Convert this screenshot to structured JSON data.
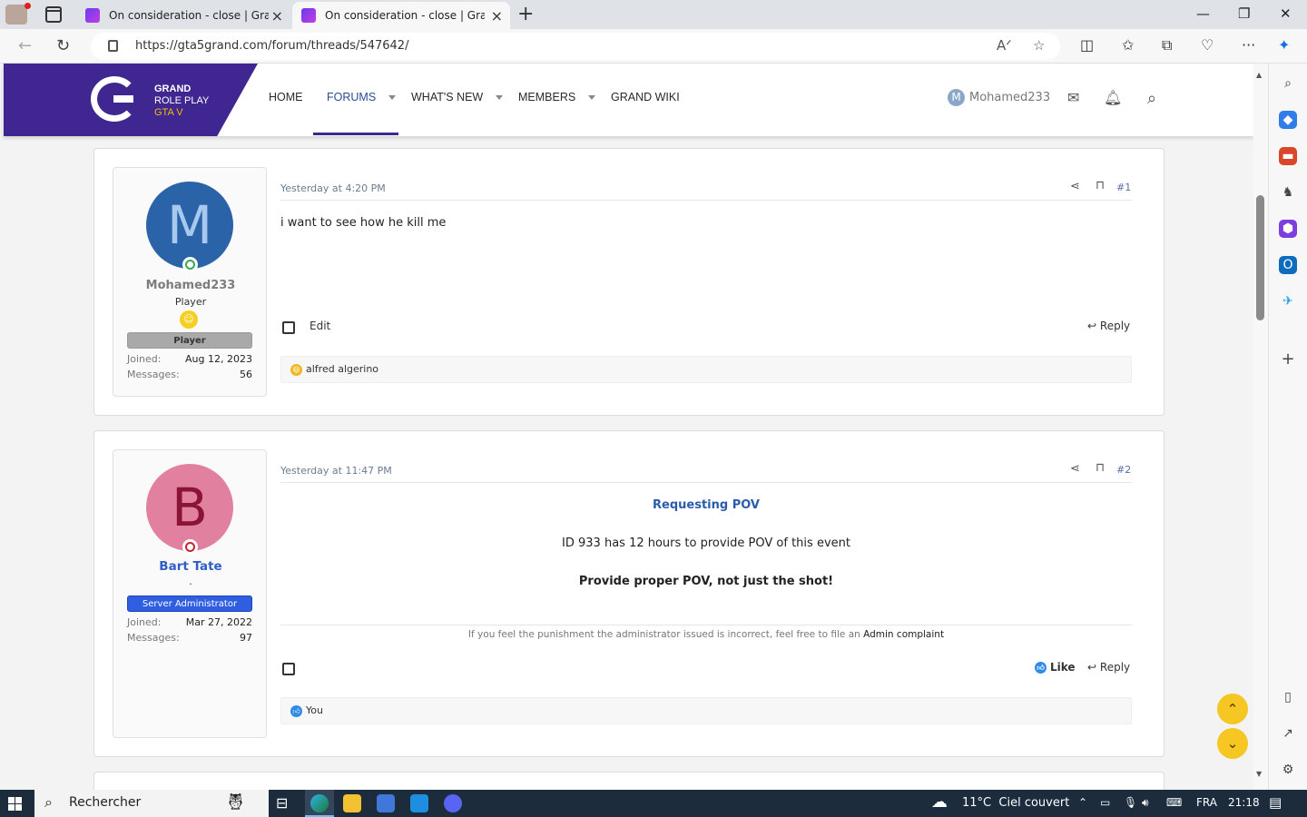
{
  "browser": {
    "tabs": [
      {
        "title": "On consideration - close | Grand",
        "active": false
      },
      {
        "title": "On consideration - close | Grand",
        "active": true
      }
    ],
    "url": "https://gta5grand.com/forum/threads/547642/"
  },
  "site": {
    "logo": {
      "line1": "GRAND",
      "line2": "ROLE PLAY",
      "line3": "GTA V"
    },
    "nav": [
      {
        "label": "HOME"
      },
      {
        "label": "FORUMS"
      },
      {
        "label": "WHAT'S NEW"
      },
      {
        "label": "MEMBERS"
      },
      {
        "label": "GRAND WIKI"
      }
    ],
    "user": {
      "initial": "M",
      "name": "Mohamed233"
    }
  },
  "posts": [
    {
      "avatar_letter": "M",
      "username": "Mohamed233",
      "user_title": "Player",
      "banner": "Player",
      "joined_label": "Joined:",
      "joined": "Aug 12, 2023",
      "messages_label": "Messages:",
      "messages": "56",
      "time": "Yesterday at 4:20 PM",
      "number": "#1",
      "body": "i want to see how he kill me",
      "edit": "Edit",
      "reply": "Reply",
      "reactions": "alfred algerino"
    },
    {
      "avatar_letter": "B",
      "username": "Bart Tate",
      "user_title": ".",
      "banner": "Server Administrator",
      "joined_label": "Joined:",
      "joined": "Mar 27, 2022",
      "messages_label": "Messages:",
      "messages": "97",
      "time": "Yesterday at 11:47 PM",
      "number": "#2",
      "heading": "Requesting POV",
      "line1": "ID 933 has 12 hours to provide POV of this event",
      "line2": "Provide proper POV, not just the shot!",
      "signature": "If you feel the punishment the administrator issued is incorrect, feel free to file an",
      "signature_link": "Admin complaint",
      "like": "Like",
      "reply": "Reply",
      "reactions": "You"
    }
  ],
  "taskbar": {
    "search": "Rechercher",
    "weather": "11°C  Ciel couvert",
    "lang": "FRA",
    "time": "21:18"
  },
  "colors": {
    "brand_purple": "#3f2690",
    "link_blue": "#2a5caa",
    "admin_blue": "#2f5ee0",
    "fab_yellow": "#f6c623"
  }
}
